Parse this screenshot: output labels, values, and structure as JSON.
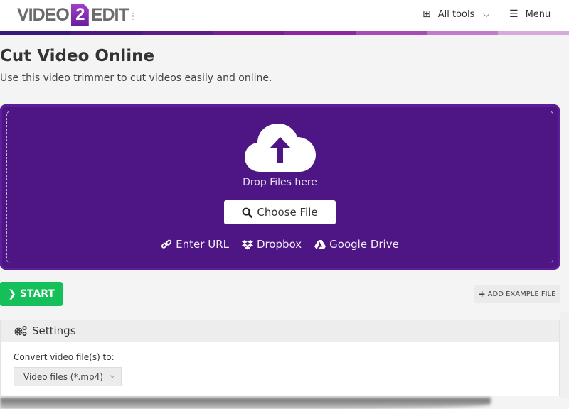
{
  "header": {
    "logo": {
      "left": "VIDEO",
      "digit": "2",
      "right": "EDIT",
      "suffix": ".com"
    },
    "all_tools_label": "All tools",
    "menu_label": "Menu",
    "icons": {
      "tools": "grid-icon",
      "chevron": "chevron-down-icon",
      "menu": "hamburger-icon"
    }
  },
  "stripe_colors": [
    "#3a1a78",
    "#4b1a82",
    "#5e1d88",
    "#7b1e95",
    "#8f25a3",
    "#a64cb5",
    "#c07bc9",
    "#d6a8dc"
  ],
  "page": {
    "title": "Cut Video Online",
    "subtitle": "Use this video trimmer to cut videos easily and online."
  },
  "dropzone": {
    "drop_text": "Drop Files here",
    "choose_label": "Choose File",
    "sources": [
      {
        "label": "Enter URL",
        "icon": "link-icon"
      },
      {
        "label": "Dropbox",
        "icon": "dropbox-icon"
      },
      {
        "label": "Google Drive",
        "icon": "google-drive-icon"
      }
    ],
    "bg_color": "#4e1585"
  },
  "actions": {
    "start_label": "START",
    "start_color": "#15c05a",
    "example_label": "ADD EXAMPLE FILE"
  },
  "settings": {
    "title": "Settings",
    "convert_label": "Convert video file(s) to:",
    "format_selected": "Video files (*.mp4)"
  }
}
